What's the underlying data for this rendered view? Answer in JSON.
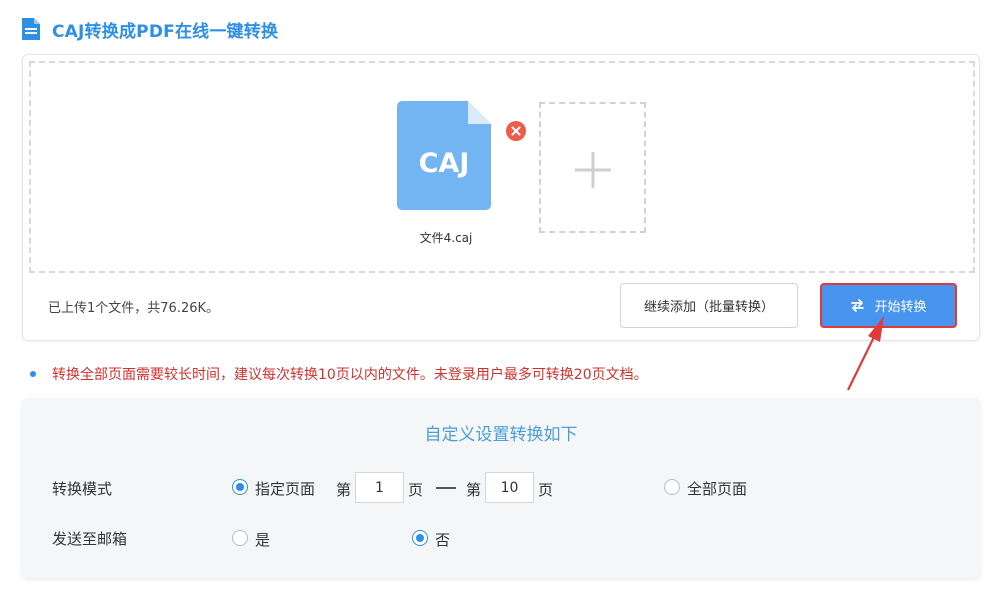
{
  "header": {
    "title": "CAJ转换成PDF在线一键转换",
    "icon": "document-icon"
  },
  "upload": {
    "file": {
      "badge": "CAJ",
      "name": "文件4.caj"
    },
    "summary": "已上传1个文件，共76.26K。",
    "continue_label": "继续添加（批量转换）",
    "start_label": "开始转换"
  },
  "notice": "转换全部页面需要较长时间，建议每次转换10页以内的文件。未登录用户最多可转换20页文档。",
  "settings": {
    "title": "自定义设置转换如下",
    "mode": {
      "label": "转换模式",
      "specify_label": "指定页面",
      "page_prefix": "第",
      "from_value": "1",
      "page_unit": "页",
      "page_prefix_2": "第",
      "to_value": "10",
      "page_unit_2": "页",
      "all_label": "全部页面",
      "selected": "指定页面"
    },
    "email": {
      "label": "发送至邮箱",
      "yes_label": "是",
      "no_label": "否",
      "selected": "否"
    }
  },
  "colors": {
    "brand": "#2e8fe6",
    "caj_icon": "#73b4f3",
    "start_button": "#4895ef",
    "highlight": "#e03a3a",
    "notice_text": "#d0312d",
    "remove_button": "#ec5d4c"
  }
}
